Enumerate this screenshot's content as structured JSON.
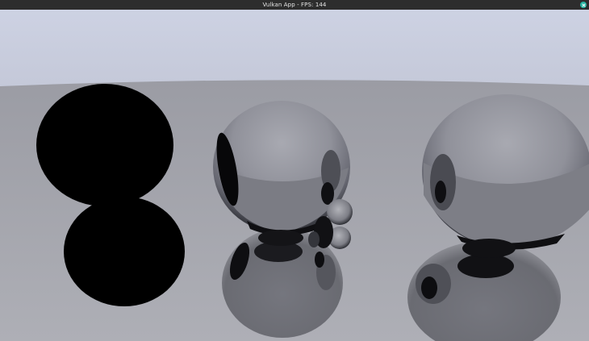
{
  "window": {
    "title": "Vulkan App - FPS: 144",
    "close_icon": "close-icon",
    "close_color": "#27b5a2"
  },
  "scene": {
    "sky_color_top": "#cdd2e3",
    "sky_color_bottom": "#c4c8d8",
    "floor_color_far": "#9b9ca4",
    "floor_color_near": "#aeafb6",
    "objects": [
      "black-sphere-left",
      "mirror-sphere-center",
      "mirror-sphere-right",
      "small-mirror-sphere"
    ]
  }
}
